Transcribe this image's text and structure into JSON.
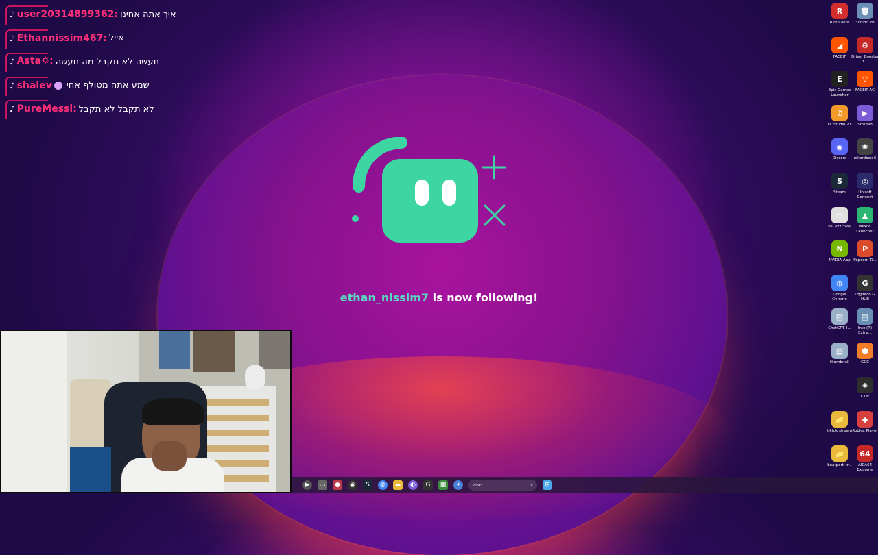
{
  "chat": {
    "messages": [
      {
        "user": "user20314899362:",
        "text": "איך אתה אחינו",
        "has_emote": false
      },
      {
        "user": "Ethannissim467:",
        "text": "אייל",
        "has_emote": false
      },
      {
        "user": "Asta🌣:",
        "text": "תעשה לא תקבל מה תעשה",
        "has_emote": false
      },
      {
        "user": "shalev",
        "text": "שמע אתה מטולף אחי",
        "has_emote": true
      },
      {
        "user": "PureMessi:",
        "text": "לא תקבל לא תקבל",
        "has_emote": false
      }
    ]
  },
  "alert": {
    "username": "ethan_nissim7",
    "message": " is now following!",
    "logo_color": "#3dd6a3"
  },
  "taskbar": {
    "search_placeholder": "חיפוש"
  },
  "desktop_icons": [
    {
      "label": "Riot Client",
      "color": "#d32e2e",
      "glyph": "R"
    },
    {
      "label": "סל המיחזור",
      "color": "#6b8fb5",
      "glyph": "🗑"
    },
    {
      "label": "FACEIT",
      "color": "#ff5500",
      "glyph": "◢"
    },
    {
      "label": "Driver Booster f...",
      "color": "#c62828",
      "glyph": "⚙"
    },
    {
      "label": "Epic Games Launcher",
      "color": "#222222",
      "glyph": "E"
    },
    {
      "label": "FACEIT AC",
      "color": "#ff5500",
      "glyph": "▽"
    },
    {
      "label": "FL Studio 21",
      "color": "#f29b2b",
      "glyph": "♫"
    },
    {
      "label": "Stremio",
      "color": "#7b5bd6",
      "glyph": "▶"
    },
    {
      "label": "Discord",
      "color": "#5865f2",
      "glyph": "◉"
    },
    {
      "label": "rekordbox 6",
      "color": "#444444",
      "glyph": "✺"
    },
    {
      "label": "Steam",
      "color": "#1b2838",
      "glyph": "S"
    },
    {
      "label": "Ubisoft Connect",
      "color": "#2b2b6b",
      "glyph": "◎"
    },
    {
      "label": "עיצוב ללא שם",
      "color": "#e0e0e0",
      "glyph": "▭"
    },
    {
      "label": "Nexon Launcher",
      "color": "#2bb673",
      "glyph": "▲"
    },
    {
      "label": "NVIDIA App",
      "color": "#76b900",
      "glyph": "N"
    },
    {
      "label": "Popcorn-Ti...",
      "color": "#d94b2b",
      "glyph": "P"
    },
    {
      "label": "Google Chrome",
      "color": "#4285f4",
      "glyph": "◍"
    },
    {
      "label": "Logitech G HUB",
      "color": "#333333",
      "glyph": "G"
    },
    {
      "label": "ChatGPT_I...",
      "color": "#9ab0c9",
      "glyph": "▤"
    },
    {
      "label": "Intel(R) Extre...",
      "color": "#6a8fb5",
      "glyph": "▤"
    },
    {
      "label": "thumbnail",
      "color": "#9ab0c9",
      "glyph": "▤"
    },
    {
      "label": "GCC",
      "color": "#f07d28",
      "glyph": "⬢"
    },
    {
      "label": "iCUE",
      "color": "#2e2e2e",
      "glyph": "◈"
    },
    {
      "label": "tiktok stream",
      "color": "#e8b93a",
      "glyph": "📁"
    },
    {
      "label": "Roblox Player",
      "color": "#d84040",
      "glyph": "◆"
    },
    {
      "label": "beatport_tr...",
      "color": "#e8b93a",
      "glyph": "📁"
    },
    {
      "label": "AIDA64 Extreme",
      "color": "#c62828",
      "glyph": "64"
    }
  ]
}
